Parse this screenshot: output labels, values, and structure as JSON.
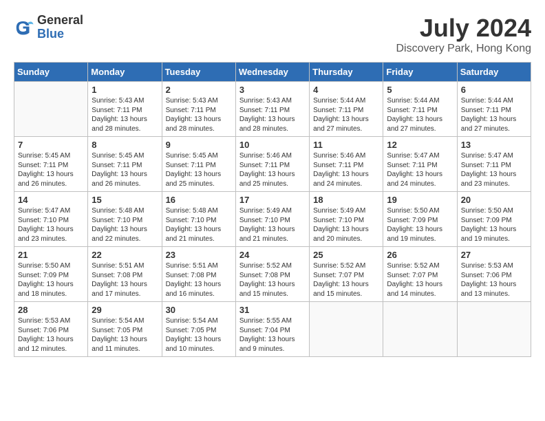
{
  "logo": {
    "general": "General",
    "blue": "Blue"
  },
  "title": {
    "month": "July 2024",
    "location": "Discovery Park, Hong Kong"
  },
  "weekdays": [
    "Sunday",
    "Monday",
    "Tuesday",
    "Wednesday",
    "Thursday",
    "Friday",
    "Saturday"
  ],
  "weeks": [
    [
      {
        "day": "",
        "sunrise": "",
        "sunset": "",
        "daylight": ""
      },
      {
        "day": "1",
        "sunrise": "Sunrise: 5:43 AM",
        "sunset": "Sunset: 7:11 PM",
        "daylight": "Daylight: 13 hours and 28 minutes."
      },
      {
        "day": "2",
        "sunrise": "Sunrise: 5:43 AM",
        "sunset": "Sunset: 7:11 PM",
        "daylight": "Daylight: 13 hours and 28 minutes."
      },
      {
        "day": "3",
        "sunrise": "Sunrise: 5:43 AM",
        "sunset": "Sunset: 7:11 PM",
        "daylight": "Daylight: 13 hours and 28 minutes."
      },
      {
        "day": "4",
        "sunrise": "Sunrise: 5:44 AM",
        "sunset": "Sunset: 7:11 PM",
        "daylight": "Daylight: 13 hours and 27 minutes."
      },
      {
        "day": "5",
        "sunrise": "Sunrise: 5:44 AM",
        "sunset": "Sunset: 7:11 PM",
        "daylight": "Daylight: 13 hours and 27 minutes."
      },
      {
        "day": "6",
        "sunrise": "Sunrise: 5:44 AM",
        "sunset": "Sunset: 7:11 PM",
        "daylight": "Daylight: 13 hours and 27 minutes."
      }
    ],
    [
      {
        "day": "7",
        "sunrise": "Sunrise: 5:45 AM",
        "sunset": "Sunset: 7:11 PM",
        "daylight": "Daylight: 13 hours and 26 minutes."
      },
      {
        "day": "8",
        "sunrise": "Sunrise: 5:45 AM",
        "sunset": "Sunset: 7:11 PM",
        "daylight": "Daylight: 13 hours and 26 minutes."
      },
      {
        "day": "9",
        "sunrise": "Sunrise: 5:45 AM",
        "sunset": "Sunset: 7:11 PM",
        "daylight": "Daylight: 13 hours and 25 minutes."
      },
      {
        "day": "10",
        "sunrise": "Sunrise: 5:46 AM",
        "sunset": "Sunset: 7:11 PM",
        "daylight": "Daylight: 13 hours and 25 minutes."
      },
      {
        "day": "11",
        "sunrise": "Sunrise: 5:46 AM",
        "sunset": "Sunset: 7:11 PM",
        "daylight": "Daylight: 13 hours and 24 minutes."
      },
      {
        "day": "12",
        "sunrise": "Sunrise: 5:47 AM",
        "sunset": "Sunset: 7:11 PM",
        "daylight": "Daylight: 13 hours and 24 minutes."
      },
      {
        "day": "13",
        "sunrise": "Sunrise: 5:47 AM",
        "sunset": "Sunset: 7:11 PM",
        "daylight": "Daylight: 13 hours and 23 minutes."
      }
    ],
    [
      {
        "day": "14",
        "sunrise": "Sunrise: 5:47 AM",
        "sunset": "Sunset: 7:10 PM",
        "daylight": "Daylight: 13 hours and 23 minutes."
      },
      {
        "day": "15",
        "sunrise": "Sunrise: 5:48 AM",
        "sunset": "Sunset: 7:10 PM",
        "daylight": "Daylight: 13 hours and 22 minutes."
      },
      {
        "day": "16",
        "sunrise": "Sunrise: 5:48 AM",
        "sunset": "Sunset: 7:10 PM",
        "daylight": "Daylight: 13 hours and 21 minutes."
      },
      {
        "day": "17",
        "sunrise": "Sunrise: 5:49 AM",
        "sunset": "Sunset: 7:10 PM",
        "daylight": "Daylight: 13 hours and 21 minutes."
      },
      {
        "day": "18",
        "sunrise": "Sunrise: 5:49 AM",
        "sunset": "Sunset: 7:10 PM",
        "daylight": "Daylight: 13 hours and 20 minutes."
      },
      {
        "day": "19",
        "sunrise": "Sunrise: 5:50 AM",
        "sunset": "Sunset: 7:09 PM",
        "daylight": "Daylight: 13 hours and 19 minutes."
      },
      {
        "day": "20",
        "sunrise": "Sunrise: 5:50 AM",
        "sunset": "Sunset: 7:09 PM",
        "daylight": "Daylight: 13 hours and 19 minutes."
      }
    ],
    [
      {
        "day": "21",
        "sunrise": "Sunrise: 5:50 AM",
        "sunset": "Sunset: 7:09 PM",
        "daylight": "Daylight: 13 hours and 18 minutes."
      },
      {
        "day": "22",
        "sunrise": "Sunrise: 5:51 AM",
        "sunset": "Sunset: 7:08 PM",
        "daylight": "Daylight: 13 hours and 17 minutes."
      },
      {
        "day": "23",
        "sunrise": "Sunrise: 5:51 AM",
        "sunset": "Sunset: 7:08 PM",
        "daylight": "Daylight: 13 hours and 16 minutes."
      },
      {
        "day": "24",
        "sunrise": "Sunrise: 5:52 AM",
        "sunset": "Sunset: 7:08 PM",
        "daylight": "Daylight: 13 hours and 15 minutes."
      },
      {
        "day": "25",
        "sunrise": "Sunrise: 5:52 AM",
        "sunset": "Sunset: 7:07 PM",
        "daylight": "Daylight: 13 hours and 15 minutes."
      },
      {
        "day": "26",
        "sunrise": "Sunrise: 5:52 AM",
        "sunset": "Sunset: 7:07 PM",
        "daylight": "Daylight: 13 hours and 14 minutes."
      },
      {
        "day": "27",
        "sunrise": "Sunrise: 5:53 AM",
        "sunset": "Sunset: 7:06 PM",
        "daylight": "Daylight: 13 hours and 13 minutes."
      }
    ],
    [
      {
        "day": "28",
        "sunrise": "Sunrise: 5:53 AM",
        "sunset": "Sunset: 7:06 PM",
        "daylight": "Daylight: 13 hours and 12 minutes."
      },
      {
        "day": "29",
        "sunrise": "Sunrise: 5:54 AM",
        "sunset": "Sunset: 7:05 PM",
        "daylight": "Daylight: 13 hours and 11 minutes."
      },
      {
        "day": "30",
        "sunrise": "Sunrise: 5:54 AM",
        "sunset": "Sunset: 7:05 PM",
        "daylight": "Daylight: 13 hours and 10 minutes."
      },
      {
        "day": "31",
        "sunrise": "Sunrise: 5:55 AM",
        "sunset": "Sunset: 7:04 PM",
        "daylight": "Daylight: 13 hours and 9 minutes."
      },
      {
        "day": "",
        "sunrise": "",
        "sunset": "",
        "daylight": ""
      },
      {
        "day": "",
        "sunrise": "",
        "sunset": "",
        "daylight": ""
      },
      {
        "day": "",
        "sunrise": "",
        "sunset": "",
        "daylight": ""
      }
    ]
  ]
}
